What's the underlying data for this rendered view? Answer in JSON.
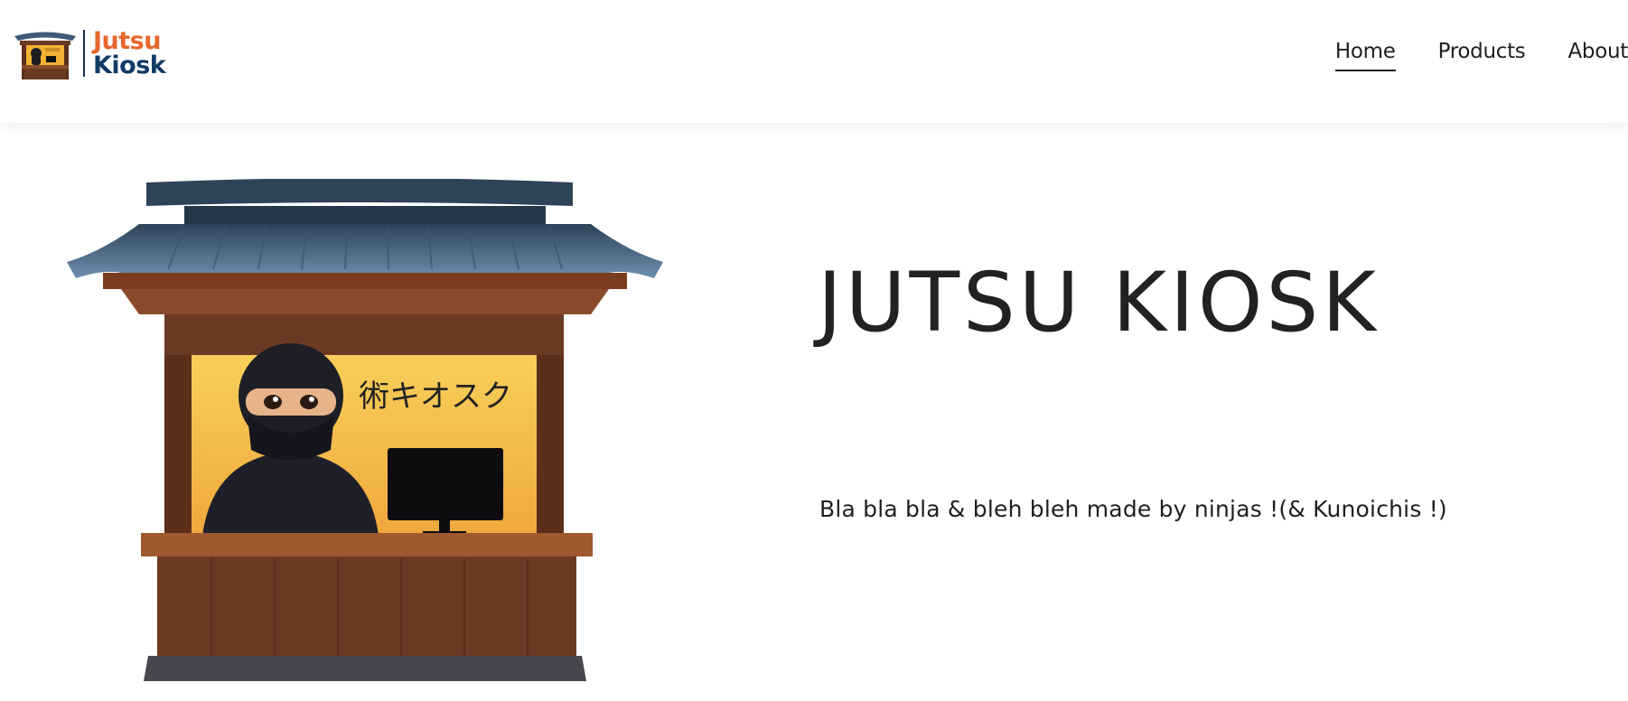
{
  "header": {
    "logo": {
      "line1": "Jutsu",
      "line2": "Kiosk"
    },
    "nav": {
      "items": [
        {
          "label": "Home",
          "active": true
        },
        {
          "label": "Products",
          "active": false
        },
        {
          "label": "About",
          "active": false
        }
      ]
    }
  },
  "hero": {
    "title": "JUTSU KIOSK",
    "subtitle": "Bla bla bla & bleh bleh made by ninjas !(& Kunoichis !)",
    "image": {
      "sign_text": "術キオスク"
    }
  },
  "colors": {
    "logo_accent": "#e8672c",
    "logo_primary": "#123b66",
    "text": "#1f1f1f",
    "roof": "#4d6b8a",
    "kiosk_wood": "#6b3a22",
    "kiosk_back": "#f2b233"
  }
}
